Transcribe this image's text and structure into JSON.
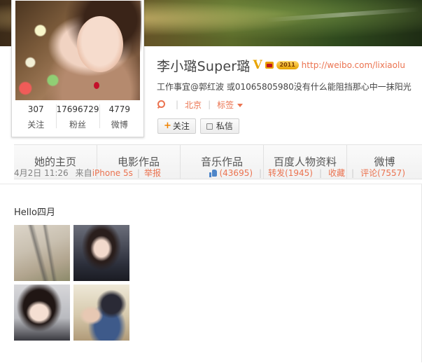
{
  "profile": {
    "name": "李小璐Super璐",
    "vip_badge": "2011",
    "link": "http://weibo.com/lixiaolu",
    "bio": "工作事宜@郭红波 或01065805980没有什么能阻挡那心中一抹阳光",
    "location": "北京",
    "tags_label": "标签",
    "follow_label": "关注",
    "message_label": "私信",
    "verified_mark": "V"
  },
  "stats": [
    {
      "value": "307",
      "label": "关注"
    },
    {
      "value": "17696729",
      "label": "粉丝"
    },
    {
      "value": "4779",
      "label": "微博"
    }
  ],
  "tabs": [
    {
      "label": "她的主页"
    },
    {
      "label": "电影作品"
    },
    {
      "label": "音乐作品"
    },
    {
      "label": "百度人物资料"
    },
    {
      "label": "微博"
    }
  ],
  "post": {
    "text": "Hello四月",
    "time": "4月2日 11:26",
    "source_prefix": "来自",
    "source": "iPhone 5s",
    "report": "举报",
    "likes": "(43695)",
    "repost": "转发(1945)",
    "favorite": "收藏",
    "comment": "评论(7557)"
  },
  "icons": {
    "verified": "verified-v-icon",
    "crown": "crown-icon",
    "location": "location-pin-icon",
    "caret": "caret-down-icon",
    "plus": "plus-icon",
    "message": "message-icon",
    "like": "thumbs-up-icon"
  },
  "colors": {
    "accent": "#eb7350",
    "verified": "#e8a400",
    "like": "#4e86c9"
  }
}
